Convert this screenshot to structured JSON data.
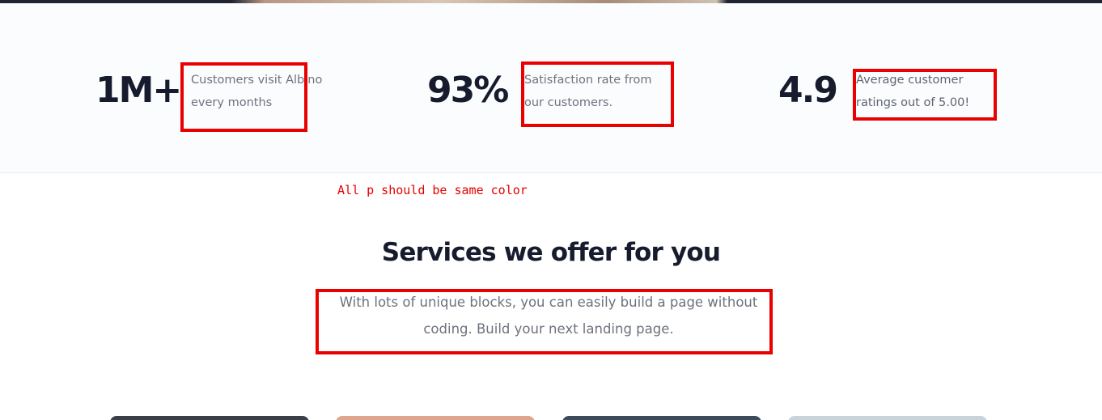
{
  "stats": [
    {
      "number": "1M+",
      "text": "Customers visit Albino\nevery months",
      "color": "#6e727d"
    },
    {
      "number": "93%",
      "text": "Satisfaction rate from\nour customers.",
      "color": "#6e727d"
    },
    {
      "number": "4.9",
      "text": "Average customer\nratings out of 5.00!",
      "color": "#5f6470"
    }
  ],
  "annotation": {
    "note": "All p should be same color",
    "color": "#e60000"
  },
  "services": {
    "heading": "Services we offer for you",
    "subtitle": "With lots of unique blocks, you can easily build a page without coding. Build your next landing page."
  },
  "cards": [
    {
      "color": "#3a3f47"
    },
    {
      "color": "#e0a58e"
    },
    {
      "color": "#3c4a5a"
    },
    {
      "color": "#c9d3da"
    }
  ]
}
